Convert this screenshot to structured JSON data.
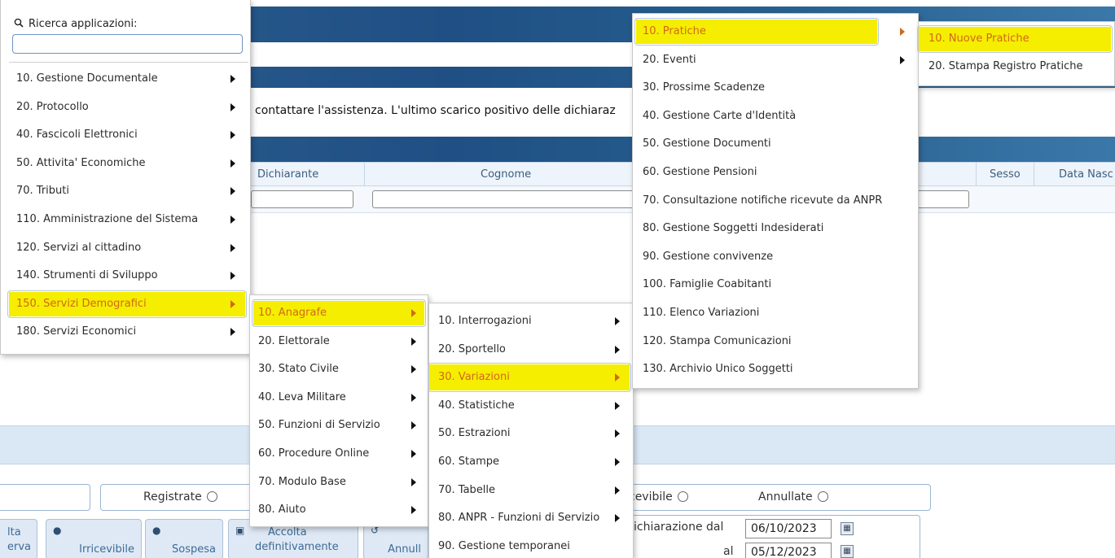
{
  "background": {
    "warning_text": "contattare l'assistenza. L'ultimo scarico positivo delle dichiaraz",
    "grid": {
      "columns": [
        "Dichiarante",
        "Cognome",
        "Sesso",
        "Data Nasc"
      ]
    },
    "radio_options": [
      {
        "label": "Registrate"
      },
      {
        "label": "cevibile"
      },
      {
        "label": "Annullate"
      }
    ],
    "buttons": [
      {
        "label_1": "lta",
        "label_2": "erva"
      },
      {
        "label": "Irricevibile"
      },
      {
        "label": "Sospesa"
      },
      {
        "label_1": "Accolta",
        "label_2": "definitivamente"
      },
      {
        "label": "Annull"
      }
    ],
    "dates": {
      "from_label": "ichiarazione dal",
      "from_value": "06/10/2023",
      "to_label": "al",
      "to_value": "05/12/2023"
    }
  },
  "search": {
    "label": "Ricerca applicazioni:",
    "icon": "search-icon",
    "value": ""
  },
  "menu_main": [
    {
      "label": "10. Gestione Documentale",
      "has_sub": true
    },
    {
      "label": "20. Protocollo",
      "has_sub": true
    },
    {
      "label": "40. Fascicoli Elettronici",
      "has_sub": true
    },
    {
      "label": "50. Attivita' Economiche",
      "has_sub": true
    },
    {
      "label": "70. Tributi",
      "has_sub": true
    },
    {
      "label": "110. Amministrazione del Sistema",
      "has_sub": true
    },
    {
      "label": "120. Servizi al cittadino",
      "has_sub": true
    },
    {
      "label": "140. Strumenti di Sviluppo",
      "has_sub": true
    },
    {
      "label": "150. Servizi Demografici",
      "has_sub": true,
      "highlighted": true
    },
    {
      "label": "180. Servizi Economici",
      "has_sub": true
    }
  ],
  "menu_demografici": [
    {
      "label": "10. Anagrafe",
      "has_sub": true,
      "highlighted": true
    },
    {
      "label": "20. Elettorale",
      "has_sub": true
    },
    {
      "label": "30. Stato Civile",
      "has_sub": true
    },
    {
      "label": "40. Leva Militare",
      "has_sub": true
    },
    {
      "label": "50. Funzioni di Servizio",
      "has_sub": true
    },
    {
      "label": "60. Procedure Online",
      "has_sub": true
    },
    {
      "label": "70. Modulo Base",
      "has_sub": true
    },
    {
      "label": "80. Aiuto",
      "has_sub": true
    }
  ],
  "menu_anagrafe": [
    {
      "label": "10. Interrogazioni",
      "has_sub": true
    },
    {
      "label": "20. Sportello",
      "has_sub": true
    },
    {
      "label": "30. Variazioni",
      "has_sub": true,
      "highlighted": true
    },
    {
      "label": "40. Statistiche",
      "has_sub": true
    },
    {
      "label": "50. Estrazioni",
      "has_sub": true
    },
    {
      "label": "60. Stampe",
      "has_sub": true
    },
    {
      "label": "70. Tabelle",
      "has_sub": true
    },
    {
      "label": "80. ANPR - Funzioni di Servizio",
      "has_sub": true
    },
    {
      "label": "90. Gestione temporanei",
      "has_sub": false
    }
  ],
  "menu_variazioni": [
    {
      "label": "10. Pratiche",
      "has_sub": true,
      "highlighted": true
    },
    {
      "label": "20. Eventi",
      "has_sub": true
    },
    {
      "label": "30. Prossime Scadenze",
      "has_sub": false
    },
    {
      "label": "40. Gestione Carte d'Identità",
      "has_sub": false
    },
    {
      "label": "50. Gestione Documenti",
      "has_sub": false
    },
    {
      "label": "60. Gestione Pensioni",
      "has_sub": false
    },
    {
      "label": "70. Consultazione notifiche ricevute da ANPR",
      "has_sub": false
    },
    {
      "label": "80. Gestione Soggetti Indesiderati",
      "has_sub": false
    },
    {
      "label": "90. Gestione convivenze",
      "has_sub": false
    },
    {
      "label": "100. Famiglie Coabitanti",
      "has_sub": false
    },
    {
      "label": "110. Elenco Variazioni",
      "has_sub": false
    },
    {
      "label": "120. Stampa Comunicazioni",
      "has_sub": false
    },
    {
      "label": "130. Archivio Unico Soggetti",
      "has_sub": false
    }
  ],
  "menu_pratiche": [
    {
      "label": "10. Nuove Pratiche",
      "has_sub": false,
      "highlighted": true
    },
    {
      "label": "20. Stampa Registro Pratiche",
      "has_sub": false
    }
  ],
  "colors": {
    "highlight": "#f5ee00",
    "highlight_text": "#d2681a",
    "header_band": "#1f4f84"
  }
}
